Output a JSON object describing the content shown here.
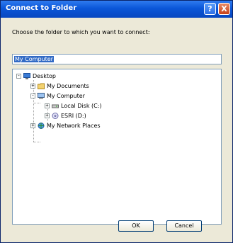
{
  "window": {
    "title": "Connect to Folder",
    "help_label": "?",
    "close_label": "X"
  },
  "prompt": "Choose the folder to which you want to connect:",
  "path_input": {
    "value": "My Computer"
  },
  "tree": {
    "desktop": "Desktop",
    "my_documents": "My Documents",
    "my_computer": "My Computer",
    "local_disk": "Local Disk (C:)",
    "esri": "ESRI (D:)",
    "network_places": "My Network Places"
  },
  "buttons": {
    "ok": "OK",
    "cancel": "Cancel"
  },
  "icons": {
    "desktop": "desktop-icon",
    "my_documents": "folder-icon",
    "my_computer": "computer-icon",
    "local_disk": "drive-icon",
    "esri": "cd-drive-icon",
    "network_places": "network-icon"
  }
}
